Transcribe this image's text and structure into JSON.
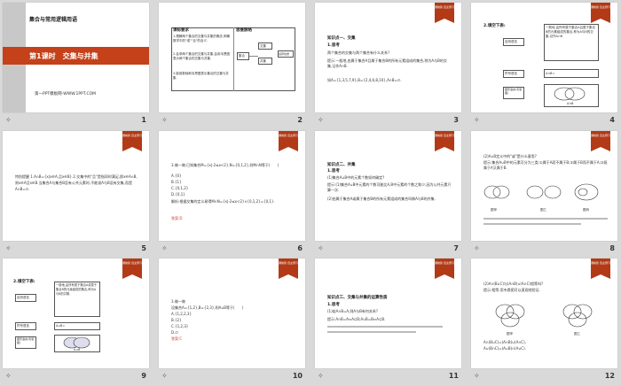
{
  "slides": [
    {
      "num": "1",
      "heading": "集合与常用逻辑用语",
      "lesson": "第1课时　交集与并集",
      "site": "第一PPT模板网-WWW.1PPT.COM"
    },
    {
      "num": "2",
      "col1": "课标要求",
      "col2": "思维脉络",
      "req1": "1.理解两个集合的交集与并集的概念,明确数学中的\"或\"\"且\"的含义.",
      "req2": "2.会求两个集合的交集与并集,会用韦恩图表示两个集合的交集与并集.",
      "req3": "3.能用数轴和韦恩图表示集合的交集与并集.",
      "tree_root": "集合",
      "tree_a": "交集",
      "tree_b": "并集",
      "tree_c": "运算性质"
    },
    {
      "num": "3",
      "banner": "课前篇 自主预习",
      "title": "知识点一、交集",
      "sub": "1.思考",
      "q": "两个集合的交集与两个集合有什么关系?",
      "body": "提示:一般地,由属于集合A且属于集合B的所有元素组成的集合,称为A与B的交集,记作A∩B.",
      "ex": "如A={1,3,5,7,9},B={2,4,6,8,10},A∩B=∅."
    },
    {
      "num": "4",
      "banner": "课前篇 自主预习",
      "title": "2.填空下表:",
      "r1": "自然语言",
      "r2": "符号语言",
      "r3": "图形语言(韦恩图)",
      "def": "一般地,由所有属于集合A且属于集合B的元素组成的集合,称为A与B的交集,记作A∩B",
      "sym": "A∩B=",
      "cap": "A∩B"
    },
    {
      "num": "5",
      "banner": "课前篇 自主预习",
      "body": "特别提醒 1.A∩B={x|x∈A,且x∈B}.2.交集中的\"且\"是指同时满足,即x∈A∩B,则x∈A且x∈B.当集合A与集合B没有公共元素时,不能说A与B没有交集,而是A∩B=∅."
    },
    {
      "num": "6",
      "banner": "课前篇 自主预习",
      "q": "3.做一做:已知集合M={x|-2≤x<2},N={0,1,2},则M∩N等于(　　)",
      "a": "A.{0}",
      "b": "B.{1}",
      "c": "C.{0,1,2}",
      "d": "D.{0,1}",
      "expl": "解析:根据交集的定义易得M∩N={x|-2≤x<2}∩{0,1,2}={0,1}.",
      "ans": "答案:D"
    },
    {
      "num": "7",
      "banner": "课前篇 自主预习",
      "title": "知识点二、并集",
      "sub": "1.思考",
      "q": "(1)集合A∪B中的元素个数如何确定?",
      "tip": "提示:(1)集合A∪B中元素的个数可能比A,B中元素的个数之和少,因为公共元素只算一次.",
      "tip2": "(2)由属于集合A或属于集合B的所有元素组成的集合叫做A与B的并集."
    },
    {
      "num": "8",
      "banner": "课前篇 自主预习",
      "q": "(2)A∪B定义中的\"或\"是什么意思?",
      "tip": "提示:集合A∪B中的元素可分为三类:①属于A而不属于B;②属于B而不属于A;③既属于A又属于B.",
      "fig1": "图甲",
      "fig2": "图乙",
      "fig3": "图丙"
    },
    {
      "num": "9",
      "banner": "课前篇 自主预习",
      "title": "2.填空下表:",
      "r1": "自然语言",
      "r2": "符号语言",
      "r3": "图形语言(韦恩图)",
      "def": "一般地,由所有属于集合A或属于集合B的元素组成的集合,称为A与B的并集",
      "sym": "A∪B=",
      "cap": "A∪B"
    },
    {
      "num": "10",
      "banner": "课前篇 自主预习",
      "q": "3.做一做",
      "body": "设集合A={1,2},B={2,3},则A∪B等于(　　)",
      "a": "A.{1,2,2,3}",
      "b": "B.{2}",
      "c": "C.{1,2,3}",
      "d": "D.∅",
      "ans": "答案:C"
    },
    {
      "num": "11",
      "banner": "课前篇 自主预习",
      "title": "知识点三、交集与并集的运算性质",
      "sub": "1.思考",
      "q": "(1)若A∩B=A,则A与B有何关系?",
      "tip": "提示:A∩B=A⇔A⊆B;A∪B=B⇔A⊆B."
    },
    {
      "num": "12",
      "banner": "课前篇 自主预习",
      "q": "(2)A∩(B∪C)与(A∩B)∪(A∩C)相等吗?",
      "tip": "提示:相等.用韦恩图可以直观地验证.",
      "fig1": "图甲",
      "fig2": "图乙",
      "l1": "A∩(B∪C)=(A∩B)∪(A∩C),",
      "l2": "A∪(B∩C)=(A∪B)∩(A∪C)."
    }
  ],
  "colors": {
    "accent": "#b23a17",
    "bg": "#d9d9d9"
  }
}
